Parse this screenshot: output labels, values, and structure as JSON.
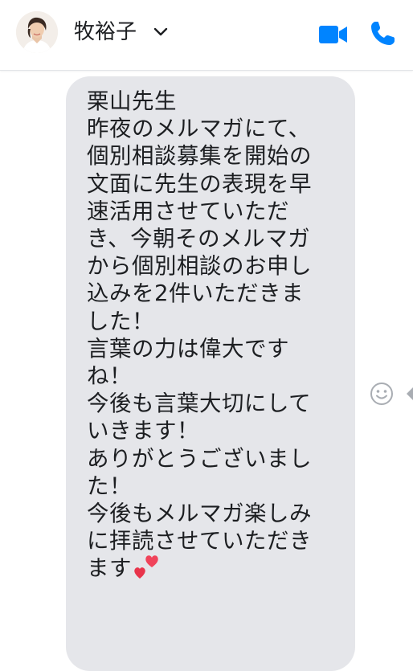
{
  "header": {
    "contact_name": "牧裕子",
    "icons": {
      "chevron": "chevron-down-icon",
      "video": "video-camera-icon",
      "call": "phone-icon"
    },
    "accent_color": "#0084ff"
  },
  "message": {
    "bubble_color": "#e5e6ea",
    "lines": [
      "栗山先生",
      "昨夜のメルマガにて、",
      "個別相談募集を開始の",
      "文面に先生の表現を早",
      "速活用させていただ",
      "き、今朝そのメルマガ",
      "から個別相談のお申し",
      "込みを2件いただきま",
      "した！",
      "言葉の力は偉大です",
      "ね！",
      "今後も言葉大切にして",
      "いきます！",
      "ありがとうございまし",
      "た！",
      "今後もメルマガ楽しみ",
      "に拝読させていただき",
      "ます"
    ],
    "trailing_emoji": "two-hearts-emoji"
  },
  "side_actions": {
    "react_icon": "smiley-face-icon",
    "more_icon": "triangle-left-icon"
  }
}
